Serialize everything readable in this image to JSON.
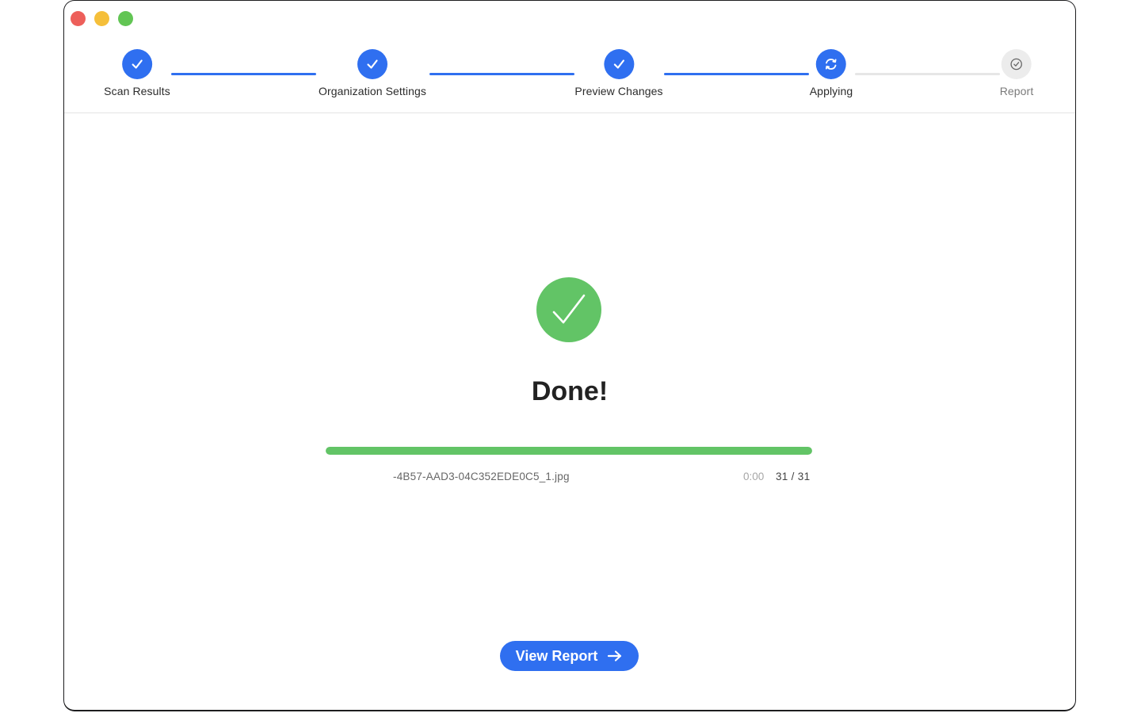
{
  "window": {
    "controls": [
      "close",
      "minimize",
      "maximize"
    ]
  },
  "stepper": {
    "steps": [
      {
        "label": "Scan Results",
        "state": "completed",
        "icon": "checkmark-icon"
      },
      {
        "label": "Organization Settings",
        "state": "completed",
        "icon": "checkmark-icon"
      },
      {
        "label": "Preview Changes",
        "state": "completed",
        "icon": "checkmark-icon"
      },
      {
        "label": "Applying",
        "state": "current",
        "icon": "sync-icon"
      },
      {
        "label": "Report",
        "state": "pending",
        "icon": "check-circle-icon"
      }
    ]
  },
  "status": {
    "title": "Done!",
    "icon": "success-check-icon"
  },
  "progress": {
    "fraction": 1.0,
    "filename": "-4B57-AAD3-04C352EDE0C5_1.jpg",
    "elapsed": "0:00",
    "count": "31 / 31"
  },
  "actions": {
    "view_report_label": "View Report",
    "view_report_icon": "arrow-right-icon"
  },
  "colors": {
    "accent": "#2f6ff0",
    "success": "#62c466",
    "pending": "#ececec"
  }
}
